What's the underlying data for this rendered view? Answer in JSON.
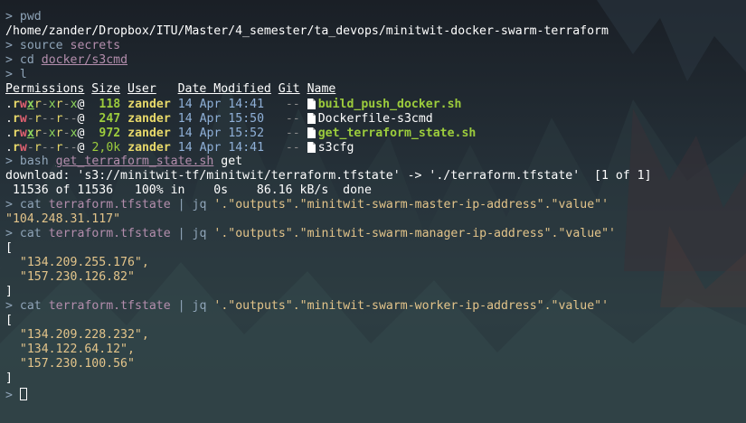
{
  "colors": {
    "prompt": "#8fa4b8",
    "arg": "#b48ead",
    "string": "#e3c48a",
    "exe": "#9ccc3c",
    "date": "#8fb0d8"
  },
  "prompt_symbol": ">",
  "cmd_pwd": "pwd",
  "pwd_output": "/home/zander/Dropbox/ITU/Master/4_semester/ta_devops/minitwit-docker-swarm-terraform",
  "cmd_source": "source",
  "arg_secrets": "secrets",
  "cmd_cd": "cd",
  "arg_dir": "docker/s3cmd",
  "cmd_l": "l",
  "listing": {
    "headers": {
      "permissions": "Permissions",
      "size": "Size",
      "user": "User",
      "date": "Date Modified",
      "git": "Git",
      "name": "Name"
    },
    "rows": [
      {
        "p1": ".",
        "p2": "r",
        "p3": "w",
        "p4": "x",
        "p5": "r",
        "p6": "-",
        "p7": "x",
        "p8": "r",
        "p9": "-",
        "p10": "x",
        "attr": "@",
        "size": "118",
        "user": "zander",
        "date": "14 Apr 14:41",
        "git": "--",
        "name": "build_push_docker.sh",
        "exec": true
      },
      {
        "p1": ".",
        "p2": "r",
        "p3": "w",
        "p4": "-",
        "p5": "r",
        "p6": "-",
        "p7": "-",
        "p8": "r",
        "p9": "-",
        "p10": "-",
        "attr": "@",
        "size": "247",
        "user": "zander",
        "date": "14 Apr 15:50",
        "git": "--",
        "name": "Dockerfile-s3cmd",
        "exec": false
      },
      {
        "p1": ".",
        "p2": "r",
        "p3": "w",
        "p4": "x",
        "p5": "r",
        "p6": "-",
        "p7": "x",
        "p8": "r",
        "p9": "-",
        "p10": "x",
        "attr": "@",
        "size": "972",
        "user": "zander",
        "date": "14 Apr 15:52",
        "git": "--",
        "name": "get_terraform_state.sh",
        "exec": true
      },
      {
        "p1": ".",
        "p2": "r",
        "p3": "w",
        "p4": "-",
        "p5": "r",
        "p6": "-",
        "p7": "-",
        "p8": "r",
        "p9": "-",
        "p10": "-",
        "attr": "@",
        "size": "2,0k",
        "user": "zander",
        "date": "14 Apr 14:41",
        "git": "--",
        "name": "s3cfg",
        "exec": false
      }
    ]
  },
  "cmd_bash": "bash",
  "arg_script": "get_terraform_state.sh",
  "arg_get": "get",
  "download_line": "download: 's3://minitwit-tf/minitwit/terraform.tfstate' -> './terraform.tfstate'  [1 of 1]",
  "progress_line": " 11536 of 11536   100% in    0s    86.16 kB/s  done",
  "cmd_cat": "cat",
  "arg_tfstate": "terraform.tfstate",
  "pipe": "|",
  "cmd_jq": "jq",
  "jq_master": "'.\"outputs\".\"minitwit-swarm-master-ip-address\".\"value\"'",
  "master_ip": "\"104.248.31.117\"",
  "jq_manager": "'.\"outputs\".\"minitwit-swarm-manager-ip-address\".\"value\"'",
  "manager_ips": [
    "\"134.209.255.176\",",
    "\"157.230.126.82\""
  ],
  "jq_worker": "'.\"outputs\".\"minitwit-swarm-worker-ip-address\".\"value\"'",
  "worker_ips": [
    "\"134.209.228.232\",",
    "\"134.122.64.12\",",
    "\"157.230.100.56\""
  ],
  "bracket_open": "[",
  "bracket_close": "]"
}
